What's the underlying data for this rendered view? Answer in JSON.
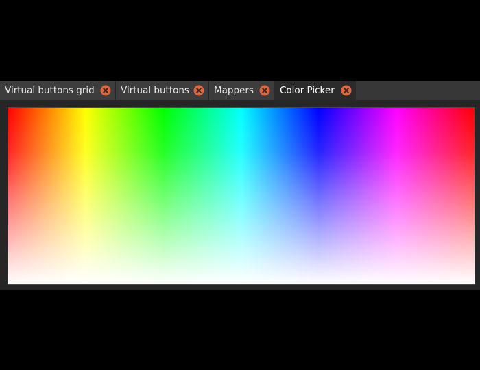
{
  "tabs": [
    {
      "label": "Virtual buttons grid",
      "active": false,
      "close_icon": "close-circle-icon"
    },
    {
      "label": "Virtual buttons",
      "active": false,
      "close_icon": "close-circle-icon"
    },
    {
      "label": "Mappers",
      "active": false,
      "close_icon": "close-circle-icon"
    },
    {
      "label": "Color Picker",
      "active": true,
      "close_icon": "close-circle-icon"
    }
  ],
  "colors": {
    "background": "#000000",
    "panel": "#262626",
    "tab": "#3d3d3d",
    "tab_active": "#2b2b2b",
    "close_button": "#e0663e"
  },
  "color_picker": {
    "hue_stops": [
      "#ff0000",
      "#ffff00",
      "#00ff00",
      "#00ffff",
      "#0000ff",
      "#ff00ff",
      "#ff0000"
    ],
    "bottom_fade": "#ffffff"
  }
}
